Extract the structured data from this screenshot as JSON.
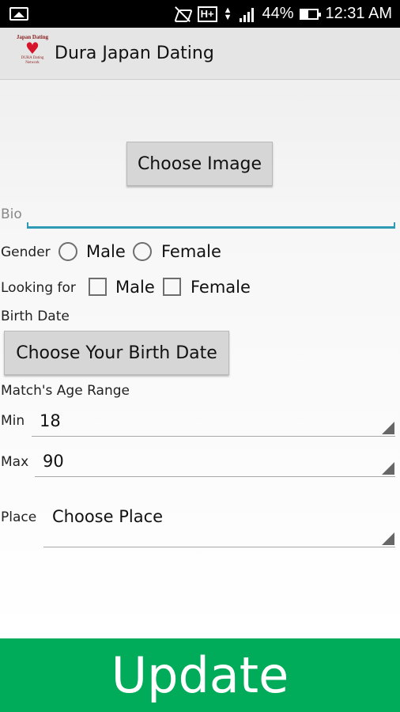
{
  "status_bar": {
    "battery": "44%",
    "time": "12:31 AM",
    "network": "H+"
  },
  "app": {
    "title": "Dura Japan Dating",
    "logo_top": "Japan Dating",
    "logo_bottom": "DURA Dating Network"
  },
  "form": {
    "choose_image_label": "Choose Image",
    "bio_label": "Bio",
    "bio_value": "",
    "gender": {
      "label": "Gender",
      "options": [
        "Male",
        "Female"
      ]
    },
    "looking_for": {
      "label": "Looking for",
      "options": [
        "Male",
        "Female"
      ]
    },
    "birth_date": {
      "label": "Birth Date",
      "button_label": "Choose Your Birth Date"
    },
    "age_range": {
      "label": "Match's Age Range",
      "min_label": "Min",
      "min_value": "18",
      "max_label": "Max",
      "max_value": "90"
    },
    "place": {
      "label": "Place",
      "value": "Choose Place"
    },
    "update_label": "Update"
  },
  "colors": {
    "accent_underline": "#2f9ab5",
    "update_button": "#00ab5a",
    "status_bar": "#000000",
    "action_bar": "#e5e5e5"
  }
}
